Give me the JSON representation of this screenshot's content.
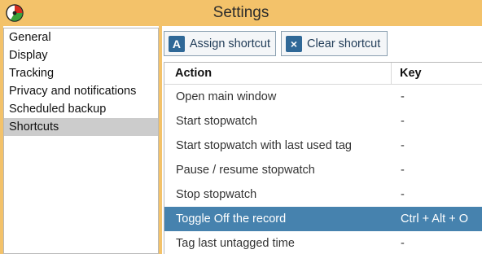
{
  "window": {
    "title": "Settings"
  },
  "sidebar": {
    "items": [
      {
        "label": "General"
      },
      {
        "label": "Display"
      },
      {
        "label": "Tracking"
      },
      {
        "label": "Privacy and notifications"
      },
      {
        "label": "Scheduled backup"
      },
      {
        "label": "Shortcuts",
        "selected": true
      }
    ]
  },
  "toolbar": {
    "assign_icon": "A",
    "assign_label": "Assign shortcut",
    "clear_icon": "×",
    "clear_label": "Clear shortcut"
  },
  "table": {
    "headers": {
      "action": "Action",
      "key": "Key"
    },
    "rows": [
      {
        "action": "Open main window",
        "key": "-"
      },
      {
        "action": "Start stopwatch",
        "key": "-"
      },
      {
        "action": "Start stopwatch with last used tag",
        "key": "-"
      },
      {
        "action": "Pause / resume stopwatch",
        "key": "-"
      },
      {
        "action": "Stop stopwatch",
        "key": "-"
      },
      {
        "action": "Toggle Off the record",
        "key": "Ctrl + Alt + O",
        "selected": true
      },
      {
        "action": "Tag last untagged time",
        "key": "-"
      }
    ]
  },
  "colors": {
    "frame": "#f3c26a",
    "selection_blue": "#4682ae",
    "sidebar_selection": "#cccccc"
  }
}
